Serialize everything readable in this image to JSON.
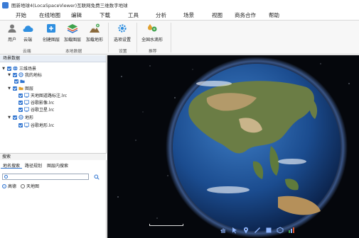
{
  "window": {
    "title": "图新地球4(LocaSpaceViewer)互联网免费三维数字地球"
  },
  "menu": [
    "开始",
    "在线地图",
    "编辑",
    "下载",
    "工具",
    "分析",
    "场景",
    "视图",
    "商务合作",
    "帮助"
  ],
  "ribbon": {
    "buttons": [
      {
        "label": "用户",
        "icon": "user-icon"
      },
      {
        "label": "云端",
        "icon": "cloud-icon"
      },
      {
        "label": "创建图层",
        "icon": "add-layer-icon"
      },
      {
        "label": "加载图层",
        "icon": "load-layer-icon"
      },
      {
        "label": "加载地形",
        "icon": "load-terrain-icon"
      },
      {
        "label": "选项设置",
        "icon": "settings-gear-icon"
      },
      {
        "label": "全国水滴形",
        "icon": "drop-shape-icon"
      }
    ],
    "groups": [
      "云端",
      "本地数据",
      "设置",
      "推荐"
    ]
  },
  "layers_panel": {
    "title": "场景数据",
    "tree": [
      {
        "label": "三维场景",
        "icon": "globe-icon"
      },
      {
        "label": "我的地标",
        "icon": "pin-icon"
      },
      {
        "label": "",
        "icon": "folder-icon"
      },
      {
        "label": "图层",
        "icon": "folder-icon"
      },
      {
        "label": "天地图道路标注.lrc",
        "icon": "doc-icon"
      },
      {
        "label": "谷歌影像.lrc",
        "icon": "doc-icon"
      },
      {
        "label": "谷歌卫星.lrc",
        "icon": "doc-icon"
      },
      {
        "label": "地形",
        "icon": "pin-icon"
      },
      {
        "label": "谷歌地形.lrc",
        "icon": "doc-icon"
      }
    ]
  },
  "search_panel": {
    "title": "搜索",
    "tabs": [
      "地名搜索",
      "路径规划",
      "图层内搜索"
    ],
    "input_value": "",
    "sources": [
      {
        "label": "高德",
        "selected": true
      },
      {
        "label": "天地图",
        "selected": false
      }
    ]
  },
  "viewer": {
    "toolbar": [
      "hand-icon",
      "cursor-icon",
      "placemark-icon",
      "line-icon",
      "polygon-icon",
      "cube-icon",
      "chart-icon"
    ]
  },
  "colors": {
    "accent": "#2f74d0",
    "background_space": "#05070c",
    "ocean": "#1b4c8f",
    "land": "#6b7d45"
  }
}
